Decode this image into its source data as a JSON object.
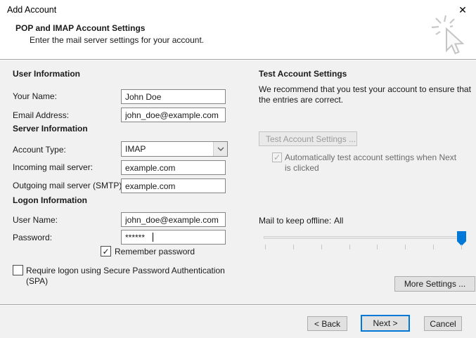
{
  "window": {
    "title": "Add Account"
  },
  "icons": {
    "close": "✕",
    "check": "✓"
  },
  "header": {
    "title": "POP and IMAP Account Settings",
    "subtitle": "Enter the mail server settings for your account."
  },
  "left": {
    "user_section": "User Information",
    "your_name": {
      "label": "Your Name:",
      "value": "John Doe"
    },
    "email": {
      "label": "Email Address:",
      "value": "john_doe@example.com"
    },
    "server_section": "Server Information",
    "account_type": {
      "label": "Account Type:",
      "value": "IMAP"
    },
    "incoming": {
      "label": "Incoming mail server:",
      "value": "example.com"
    },
    "outgoing": {
      "label": "Outgoing mail server (SMTP):",
      "value": "example.com"
    },
    "logon_section": "Logon Information",
    "username": {
      "label": "User Name:",
      "value": "john_doe@example.com"
    },
    "password": {
      "label": "Password:",
      "value": "******"
    },
    "remember_password": {
      "label": "Remember password",
      "checked": true
    },
    "spa": {
      "label": "Require logon using Secure Password Authentication (SPA)",
      "checked": false
    }
  },
  "right": {
    "test_section": "Test Account Settings",
    "description": "We recommend that you test your account to ensure that the entries are correct.",
    "test_button": "Test Account Settings ...",
    "auto_test": {
      "label": "Automatically test account settings when Next is clicked",
      "checked": true,
      "disabled": true
    },
    "offline": {
      "label": "Mail to keep offline:",
      "value": "All"
    },
    "more_settings_button": "More Settings ..."
  },
  "footer": {
    "back": "< Back",
    "next": "Next >",
    "cancel": "Cancel"
  },
  "colors": {
    "accent": "#0078d7",
    "body_bg": "#f1f1f1",
    "banner_bg": "#ffffff",
    "disabled_text": "#9b9b9b"
  }
}
